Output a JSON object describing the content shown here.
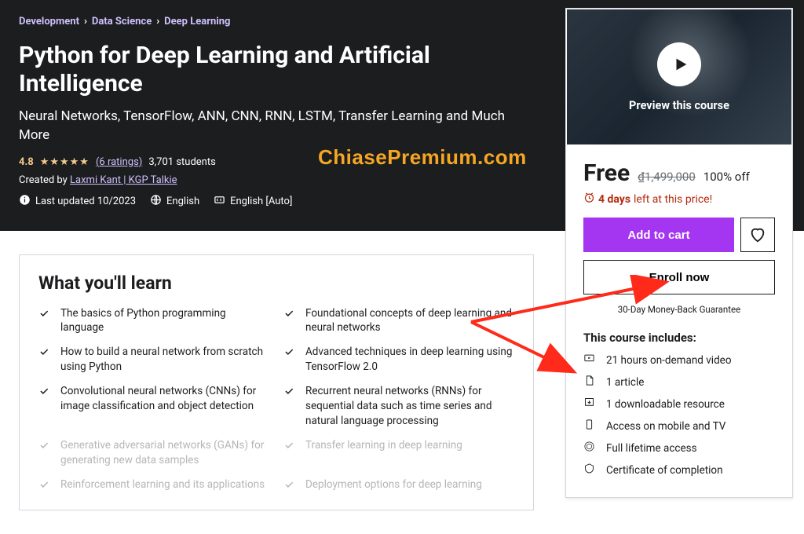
{
  "breadcrumb": [
    "Development",
    "Data Science",
    "Deep Learning"
  ],
  "title": "Python for Deep Learning and Artificial Intelligence",
  "subtitle": "Neural Networks, TensorFlow, ANN, CNN, RNN, LSTM, Transfer Learning and Much More",
  "rating": {
    "value": "4.8",
    "count_text": "(6 ratings)",
    "students": "3,701 students"
  },
  "created_by_prefix": "Created by ",
  "author": "Laxmi Kant | KGP Talkie",
  "meta": {
    "updated": "Last updated 10/2023",
    "language": "English",
    "captions": "English [Auto]"
  },
  "watermark": "ChiasePremium.com",
  "learn": {
    "heading": "What you'll learn",
    "items": [
      "The basics of Python programming language",
      "Foundational concepts of deep learning and neural networks",
      "How to build a neural network from scratch using Python",
      "Advanced techniques in deep learning using TensorFlow 2.0",
      "Convolutional neural networks (CNNs) for image classification and object detection",
      "Recurrent neural networks (RNNs) for sequential data such as time series and natural language processing",
      "Generative adversarial networks (GANs) for generating new data samples",
      "Transfer learning in deep learning",
      "Reinforcement learning and its applications",
      "Deployment options for deep learning"
    ]
  },
  "preview_label": "Preview this course",
  "pricing": {
    "price": "Free",
    "original": "₫1,499,000",
    "discount": "100% off",
    "timer_days": "4 days",
    "timer_rest": "left at this price!"
  },
  "buttons": {
    "cart": "Add to cart",
    "enroll": "Enroll now"
  },
  "guarantee": "30-Day Money-Back Guarantee",
  "includes": {
    "heading": "This course includes:",
    "items": [
      "21 hours on-demand video",
      "1 article",
      "1 downloadable resource",
      "Access on mobile and TV",
      "Full lifetime access",
      "Certificate of completion"
    ]
  }
}
